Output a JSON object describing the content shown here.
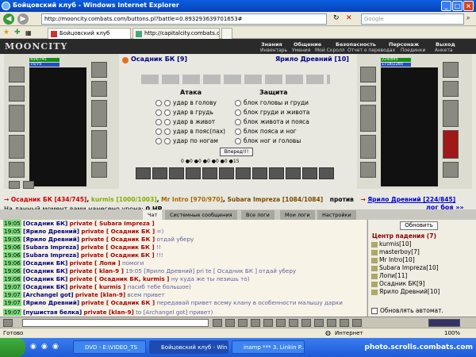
{
  "window": {
    "title": "Бойцовский клуб - Windows Internet Explorer"
  },
  "address": {
    "url": "http://mooncity.combats.com/buttons.pl?battle=0.893293639701653#",
    "search_placeholder": "Google"
  },
  "tabs": [
    {
      "label": "Бойцовский клуб"
    },
    {
      "label": "http://capitalcity.combats.co..."
    }
  ],
  "site": {
    "logo": "MOONCITY",
    "top_nav": [
      "Знания",
      "Общение",
      "Безопасность",
      "Персонаж",
      "Выход"
    ],
    "sub_nav": [
      "Инвентарь",
      "Умения",
      "Мой Скролл",
      "Отчет о переводах",
      "Поединки",
      "Анкета"
    ]
  },
  "battle": {
    "left": {
      "name": "Осадник БК [9]",
      "hp": "434/745",
      "mana": "75/75"
    },
    "right": {
      "name": "Ярило Древний [10]",
      "hp": "224/845",
      "mana": "1718/2285"
    },
    "attack_title": "Атака",
    "defense_title": "Защита",
    "attacks": [
      "удар в голову",
      "удар в грудь",
      "удар в живот",
      "удар в пояс(пах)",
      "удар по ногам"
    ],
    "defenses": [
      "блок головы и груди",
      "блок груди и живота",
      "блок живота и пояса",
      "блок пояса и ног",
      "блок ног и головы"
    ],
    "fight_button": "Вперед!!!",
    "counters": [
      "0",
      "0",
      "0",
      "0",
      "0",
      "0",
      "15"
    ],
    "team_left": [
      "Осадник БК [434/745]",
      "kurmis [1000/1003]",
      "Mr Intro [970/970]",
      "Subara Impreza [1084/1084]"
    ],
    "vs": "против",
    "team_right": [
      "Ярило Древний [224/845]"
    ],
    "damage_line": "На данный момент вами нанесено урона:",
    "damage_value": "0 HP.",
    "log_link": "лог боя »»"
  },
  "chat_tabs": [
    "Чат",
    "Системные сообщения",
    "Все логи",
    "Мои логи",
    "Настройки"
  ],
  "chat": [
    {
      "time": "19:05",
      "from": "[Осадник БК]",
      "priv": "private [ Subara Impreza ]",
      "text": ""
    },
    {
      "time": "19:05",
      "from": "[Ярило Древний]",
      "priv": "private [ Осадник БК ]",
      "text": "=)"
    },
    {
      "time": "19:05",
      "from": "[Ярило Древний]",
      "priv": "private [ Осадник БК ]",
      "text": "отдай уберу"
    },
    {
      "time": "19:06",
      "from": "[Subara Impreza]",
      "priv": "private [ Осадник БК ]",
      "text": "!!"
    },
    {
      "time": "19:06",
      "from": "[Subara Impreza]",
      "priv": "private [ Осадник БК ]",
      "text": "!!!"
    },
    {
      "time": "19:06",
      "from": "[Осадник БК]",
      "priv": "private [ Лопи ]",
      "text": "помоги"
    },
    {
      "time": "19:06",
      "from": "[Осадник БК]",
      "priv": "private [ klan-9 ]",
      "text": "19:05 [Ярило Древний] pri te [ Осадник БК ] отдай уберу"
    },
    {
      "time": "19:06",
      "from": "[Осадник БК]",
      "priv": "private [ Осадник БК, kurmis ]",
      "text": "ну куда же ты лезишь то)"
    },
    {
      "time": "19:07",
      "from": "[Осадник БК]",
      "priv": "private [ kurmis ]",
      "text": "пасиб тебе большое)"
    },
    {
      "time": "19:07",
      "from": "[Archangel got]",
      "priv": "private [klan-9]",
      "text": "всем привет"
    },
    {
      "time": "19:07",
      "from": "[Ярило Древний]",
      "priv": "private [ Осадник БК ]",
      "text": "передавай привет всему клану в особенности малышу дарки"
    },
    {
      "time": "19:07",
      "from": "[пушистая белка]",
      "priv": "private [klan-9]",
      "text": "to [Archangel got] привет)"
    }
  ],
  "room": {
    "refresh": "Обновить",
    "location": "Центр падения (7)",
    "users": [
      "kurmis[10]",
      "masterboy[7]",
      "Mr Intro[10]",
      "Subara Impreza[10]",
      "Лопи[11]",
      "Осадник БК[9]",
      "Ярило Древний[10]"
    ],
    "auto_refresh": "Обновлять автомат."
  },
  "statusbar": {
    "left": "Готово",
    "zone": "Интернет",
    "zoom": "100%"
  },
  "taskbar": {
    "start": "",
    "items": [
      "DVD - E:\\VIDEO_TS",
      "Бойцовский клуб - Win...",
      "inamp *** 3. Linkin P..."
    ],
    "watermark": "photo.scrolls.combats.com"
  }
}
